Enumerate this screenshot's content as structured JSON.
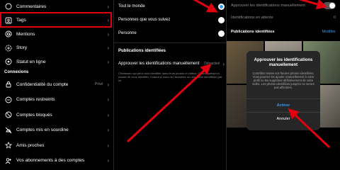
{
  "panel1": {
    "items_top": [
      {
        "icon": "chat-icon",
        "label": "Commentaires"
      },
      {
        "icon": "tag-icon",
        "label": "Tags"
      },
      {
        "icon": "at-icon",
        "label": "Mentions"
      },
      {
        "icon": "story-icon",
        "label": "Story"
      },
      {
        "icon": "status-icon",
        "label": "Statut en ligne"
      }
    ],
    "section": "Connexions",
    "items_bottom": [
      {
        "icon": "lock-icon",
        "label": "Confidentialité du compte",
        "value": "Privé"
      },
      {
        "icon": "restricted-icon",
        "label": "Comptes restreints",
        "value": ""
      },
      {
        "icon": "blocked-icon",
        "label": "Comptes bloqués",
        "value": ""
      },
      {
        "icon": "mute-icon",
        "label": "Comptes mis en sourdine",
        "value": ""
      },
      {
        "icon": "close-friends-icon",
        "label": "Amis proches",
        "value": ""
      },
      {
        "icon": "following-icon",
        "label": "Vos abonnements à des comptes",
        "value": ""
      }
    ]
  },
  "panel2": {
    "options": [
      {
        "label": "Tout le monde",
        "selected": true
      },
      {
        "label": "Personnes que vous suivez",
        "selected": false
      },
      {
        "label": "Personne",
        "selected": false
      }
    ],
    "section": "Publications identifiées",
    "manual_label": "Approuver les identifications manuellement",
    "manual_value": "Désactivé",
    "description": "Choisissez qui peut vous identifier dans leurs photos et vidéos. Quand quelqu'un essaie de vous identifier, il saura si vous ne l'acceptez ou non d'être identifié(e) par lui."
  },
  "panel3": {
    "toggle_label": "Approuver les identifications manuellement",
    "pending_label": "Identifications en attente",
    "pending_value": "0",
    "tagged_section": "Publications identifiées",
    "edit_label": "Modifier",
    "dialog": {
      "title": "Approuver les identifications manuellement",
      "body": "Contrôlez toutes vos futures photos identifiées. Vous pourrez les ajouter manuellement à votre profil ou les supprimer définitivement de votre vidéo. Les photos identifiées jusqu'ici ne seront pas affectées.",
      "confirm": "Activer",
      "cancel": "Annuler"
    }
  },
  "colors": {
    "accent": "#3797f0",
    "highlight": "#e0000f"
  }
}
